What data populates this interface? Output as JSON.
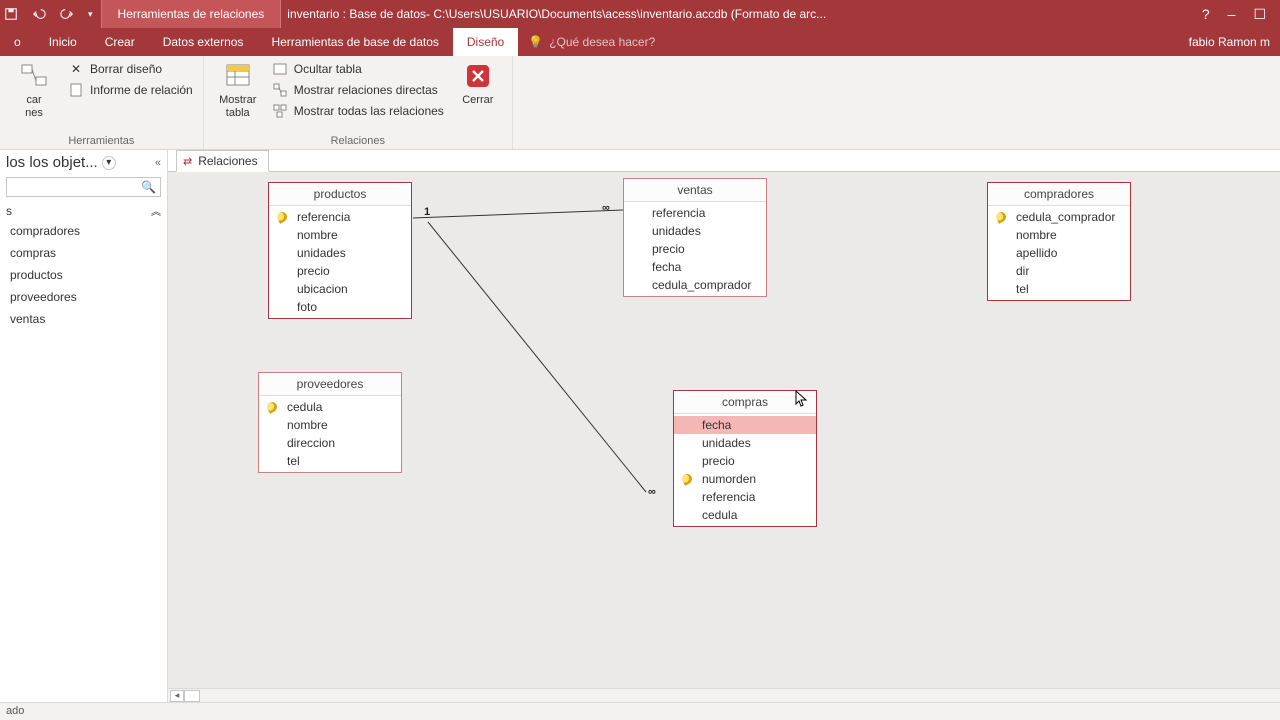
{
  "titlebar": {
    "tool_context": "Herramientas de relaciones",
    "title": "inventario : Base de datos- C:\\Users\\USUARIO\\Documents\\acess\\inventario.accdb (Formato de arc..."
  },
  "win": {
    "help": "?",
    "min": "–",
    "max": "☐"
  },
  "tabs": {
    "t0": "o",
    "t1": "Inicio",
    "t2": "Crear",
    "t3": "Datos externos",
    "t4": "Herramientas de base de datos",
    "t5": "Diseño"
  },
  "tellme": {
    "placeholder": "¿Qué desea hacer?"
  },
  "user": "fabio Ramon m",
  "ribbon": {
    "g1": {
      "b1": "car\nnes",
      "b2": "Borrar diseño",
      "b3": "Informe de relación",
      "label": "Herramientas"
    },
    "g2": {
      "b1": "Mostrar\ntabla",
      "m1": "Ocultar tabla",
      "m2": "Mostrar relaciones directas",
      "m3": "Mostrar todas las relaciones",
      "close": "Cerrar",
      "label": "Relaciones"
    }
  },
  "nav": {
    "title": "los los objet...",
    "group": "s",
    "items": [
      "compradores",
      "compras",
      "productos",
      "proveedores",
      "ventas"
    ]
  },
  "doc_tab": "Relaciones",
  "tables": {
    "productos": {
      "title": "productos",
      "fields": [
        "referencia",
        "nombre",
        "unidades",
        "precio",
        "ubicacion",
        "foto"
      ],
      "keys": [
        0
      ]
    },
    "ventas": {
      "title": "ventas",
      "fields": [
        "referencia",
        "unidades",
        "precio",
        "fecha",
        "cedula_comprador"
      ],
      "keys": []
    },
    "compradores": {
      "title": "compradores",
      "fields": [
        "cedula_comprador",
        "nombre",
        "apellido",
        "dir",
        "tel"
      ],
      "keys": [
        0
      ]
    },
    "proveedores": {
      "title": "proveedores",
      "fields": [
        "cedula",
        "nombre",
        "direccion",
        "tel"
      ],
      "keys": [
        0
      ]
    },
    "compras": {
      "title": "compras",
      "fields": [
        "fecha",
        "unidades",
        "precio",
        "numorden",
        "referencia",
        "cedula"
      ],
      "keys": [
        3
      ],
      "selected": [
        0
      ]
    }
  },
  "rel": {
    "one": "1",
    "many": "∞"
  },
  "status": "ado"
}
